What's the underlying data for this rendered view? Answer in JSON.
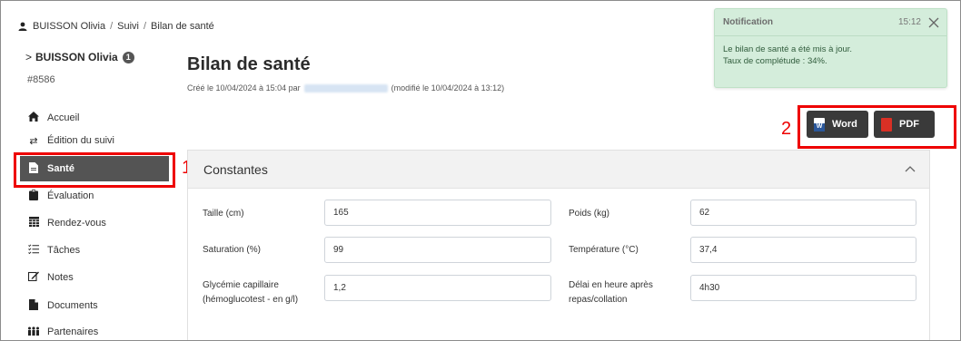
{
  "breadcrumb": {
    "items": [
      "BUISSON Olivia",
      "Suivi",
      "Bilan de santé"
    ],
    "separator": "/"
  },
  "sidebar": {
    "user_name": "BUISSON Olivia",
    "user_badge": "1",
    "user_id": "#8586",
    "items": [
      {
        "label": "Accueil",
        "icon": "home-icon"
      },
      {
        "label": "Édition du suivi",
        "icon": "swap-arrows-icon"
      },
      {
        "label": "Santé",
        "icon": "file-icon",
        "active": true
      },
      {
        "label": "Évaluation",
        "icon": "clipboard-icon"
      },
      {
        "label": "Rendez-vous",
        "icon": "calendar-icon"
      },
      {
        "label": "Tâches",
        "icon": "checklist-icon"
      },
      {
        "label": "Notes",
        "icon": "edit-icon"
      },
      {
        "label": "Documents",
        "icon": "document-icon"
      },
      {
        "label": "Partenaires",
        "icon": "people-icon"
      }
    ]
  },
  "page": {
    "title": "Bilan de santé",
    "meta_prefix": "Créé le 10/04/2024 à 15:04 par",
    "meta_suffix": "(modifié le 10/04/2024 à 13:12)"
  },
  "export": {
    "word_label": "Word",
    "pdf_label": "PDF"
  },
  "annotations": {
    "marker_1": "1",
    "marker_2": "2",
    "color": "#ee0000"
  },
  "card": {
    "title": "Constantes",
    "fields": [
      {
        "label": "Taille (cm)",
        "value": "165"
      },
      {
        "label": "Poids (kg)",
        "value": "62"
      },
      {
        "label": "Saturation (%)",
        "value": "99"
      },
      {
        "label": "Température (°C)",
        "value": "37,4"
      },
      {
        "label": "Glycémie capillaire (hémoglucotest - en g/l)",
        "value": "1,2"
      },
      {
        "label": "Délai en heure après repas/collation",
        "value": "4h30"
      }
    ]
  },
  "notification": {
    "title": "Notification",
    "time": "15:12",
    "line1": "Le bilan de santé a été mis à jour.",
    "line2": "Taux de complétude : 34%.",
    "background": "#d4eddb"
  },
  "colors": {
    "active_nav": "#545454",
    "button_dark": "#3a3a3a",
    "word_blue": "#2b579a",
    "pdf_red": "#d93025"
  }
}
